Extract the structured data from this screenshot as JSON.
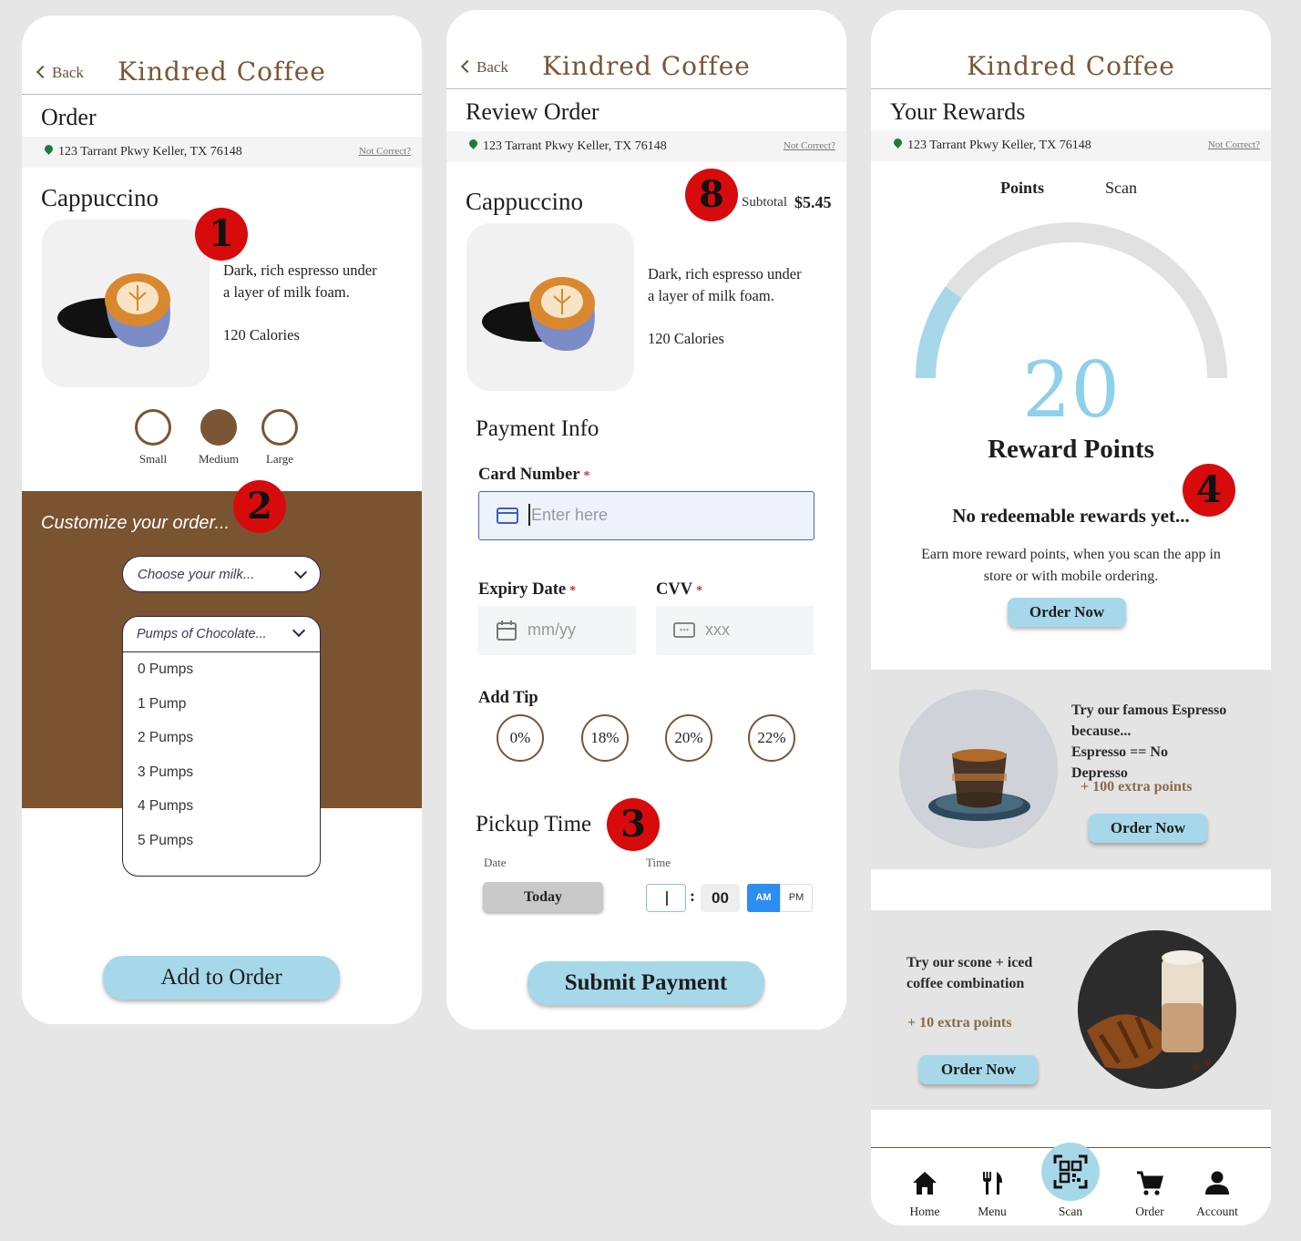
{
  "brand": "Kindred Coffee",
  "address": "123 Tarrant Pkwy Keller, TX 76148",
  "not_correct": "Not Correct?",
  "back_label": "Back",
  "product": {
    "name": "Cappuccino",
    "desc1": "Dark, rich espresso under",
    "desc2": "a layer of milk foam.",
    "calories": "120 Calories"
  },
  "screen1": {
    "title": "Order",
    "badge1": "1",
    "badge2": "2",
    "sizes": [
      "Small",
      "Medium",
      "Large"
    ],
    "selected_size": "Medium",
    "customize": "Customize your order...",
    "milk_placeholder": "Choose your milk...",
    "chocolate_placeholder": "Pumps of Chocolate...",
    "pump_options": [
      "0 Pumps",
      "1 Pump",
      "2 Pumps",
      "3 Pumps",
      "4 Pumps",
      "5 Pumps"
    ],
    "add_button": "Add to Order"
  },
  "screen2": {
    "title": "Review Order",
    "badge8": "8",
    "subtotal_label": "Subtotal",
    "subtotal_value": "$5.45",
    "payment_title": "Payment Info",
    "card_label": "Card Number",
    "card_placeholder": "Enter here",
    "expiry_label": "Expiry Date",
    "expiry_placeholder": "mm/yy",
    "cvv_label": "CVV",
    "cvv_placeholder": "xxx",
    "required_mark": "*",
    "tip_label": "Add Tip",
    "tips": [
      "0%",
      "18%",
      "20%",
      "22%"
    ],
    "pickup_title": "Pickup Time",
    "badge3": "3",
    "date_label": "Date",
    "time_label": "Time",
    "date_value": "Today",
    "minutes": "00",
    "am": "AM",
    "pm": "PM",
    "time_colon": ":",
    "submit_button": "Submit Payment"
  },
  "screen3": {
    "title": "Your Rewards",
    "tab_points": "Points",
    "tab_scan": "Scan",
    "points": "20",
    "points_fraction": 0.2,
    "points_label": "Reward Points",
    "badge4": "4",
    "no_rewards": "No redeemable rewards yet...",
    "earn1": "Earn more reward points, when you scan the app in",
    "earn2": "store or with mobile ordering.",
    "order_now": "Order Now",
    "promo1": {
      "line1": "Try our famous Espresso",
      "line2": "because...",
      "line3": "Espresso == No",
      "line4": "Depresso",
      "points": "+ 100 extra points"
    },
    "promo2": {
      "line1": "Try our scone + iced",
      "line2": "coffee combination",
      "points": "+ 10 extra points"
    },
    "nav": [
      "Home",
      "Menu",
      "Scan",
      "Order",
      "Account"
    ],
    "colors": {
      "accent": "#a6d8ea",
      "gauge_track": "#e1e1e1",
      "brown": "#7a5634"
    }
  }
}
